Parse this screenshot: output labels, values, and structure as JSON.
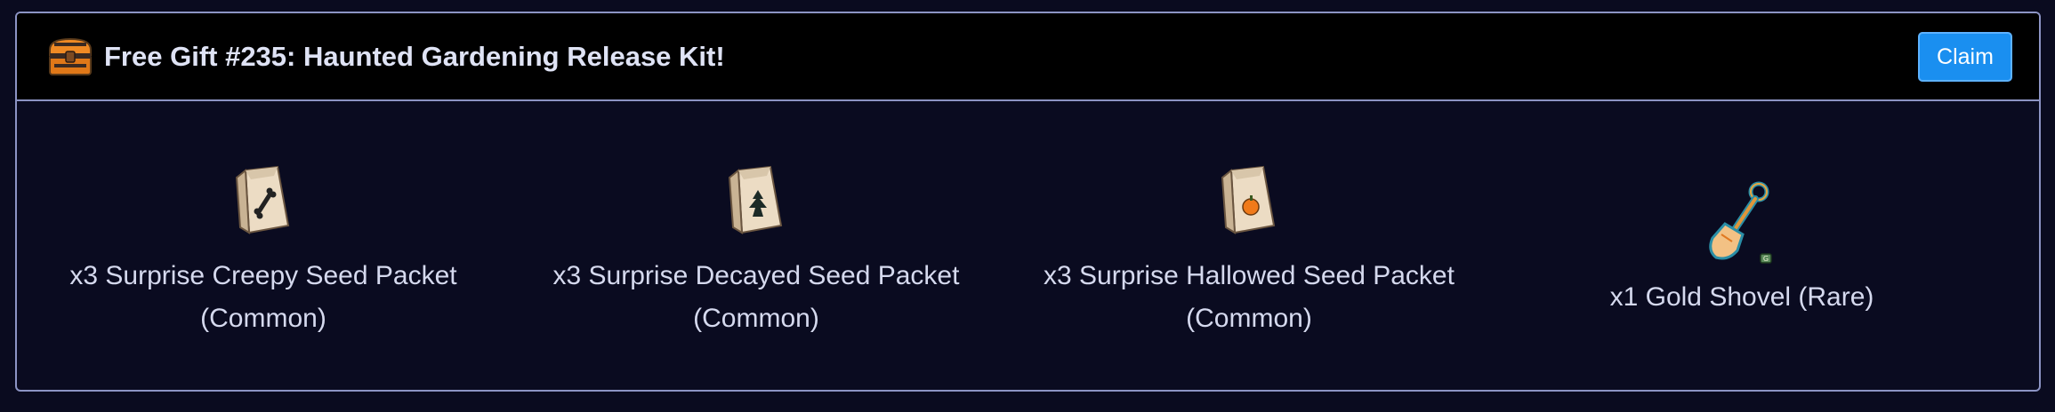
{
  "gift": {
    "title": "Free Gift #235: Haunted Gardening Release Kit!",
    "claim_label": "Claim",
    "icon": "treasure-chest-icon"
  },
  "rewards": [
    {
      "line1": "x3 Surprise Creepy Seed Packet",
      "line2": "(Common)",
      "icon": "seed-packet-bone-icon"
    },
    {
      "line1": "x3 Surprise Decayed Seed Packet",
      "line2": "(Common)",
      "icon": "seed-packet-tree-icon"
    },
    {
      "line1": "x3 Surprise Hallowed Seed Packet",
      "line2": "(Common)",
      "icon": "seed-packet-pumpkin-icon"
    },
    {
      "line1": "x1 Gold Shovel (Rare)",
      "icon": "gold-shovel-icon"
    }
  ],
  "colors": {
    "background": "#0a0b1f",
    "header": "#000000",
    "border": "#8c94c4",
    "button": "#1a8ff0",
    "text": "#d5d9ee"
  }
}
